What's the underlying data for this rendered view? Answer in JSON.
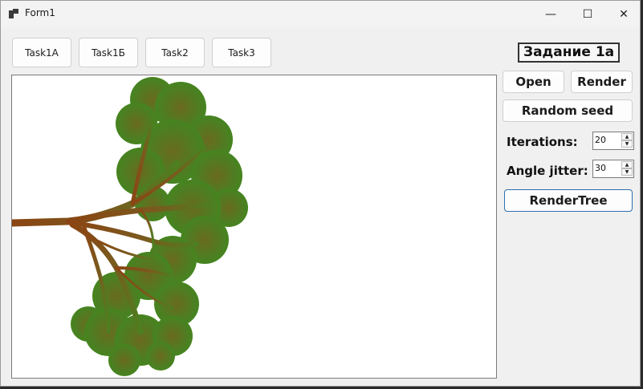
{
  "window": {
    "title": "Form1"
  },
  "controls": {
    "minimize": "—",
    "maximize": "☐",
    "close": "✕"
  },
  "tasks": [
    "Task1A",
    "Task1Б",
    "Task2",
    "Task3"
  ],
  "panel": {
    "heading": "Задание 1а",
    "open_label": "Open",
    "render_label": "Render",
    "random_seed_label": "Random seed",
    "iterations_label": "Iterations:",
    "iterations_value": "20",
    "angle_label": "Angle jitter:",
    "angle_value": "30",
    "render_tree_label": "RenderTree"
  },
  "colors": {
    "trunk": "#8B4513",
    "foliage": "#3E7E1A",
    "accent": "#2f6fb0"
  }
}
